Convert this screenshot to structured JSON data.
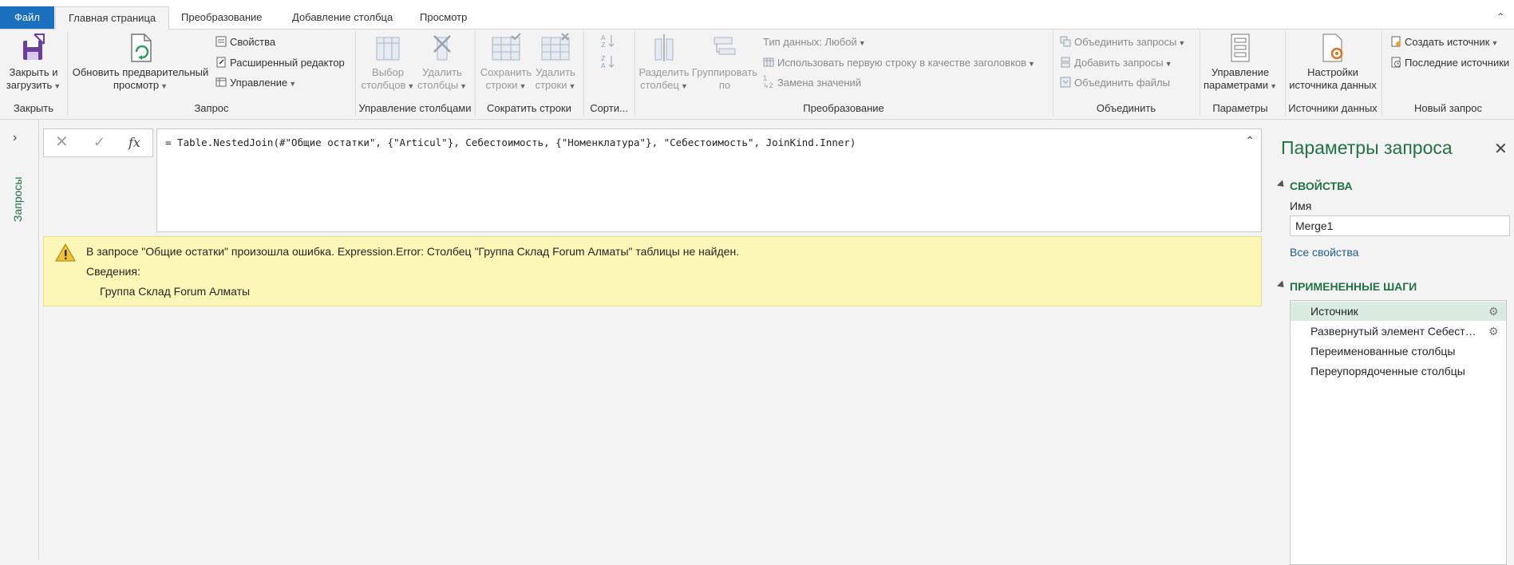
{
  "tabs": {
    "file": "Файл",
    "home": "Главная страница",
    "transform": "Преобразование",
    "add_column": "Добавление столбца",
    "view": "Просмотр"
  },
  "ribbon": {
    "close_group": {
      "close_load": [
        "Закрыть и",
        "загрузить"
      ],
      "label": "Закрыть"
    },
    "query_group": {
      "refresh": [
        "Обновить предварительный",
        "просмотр"
      ],
      "properties": "Свойства",
      "advanced_editor": "Расширенный редактор",
      "manage": "Управление",
      "label": "Запрос"
    },
    "columns_group": {
      "choose": [
        "Выбор",
        "столбцов"
      ],
      "remove": [
        "Удалить",
        "столбцы"
      ],
      "label": "Управление столбцами"
    },
    "rows_group": {
      "keep": [
        "Сохранить",
        "строки"
      ],
      "remove": [
        "Удалить",
        "строки"
      ],
      "label": "Сократить строки"
    },
    "sort_group": {
      "label": "Сорти..."
    },
    "transform_group": {
      "split": [
        "Разделить",
        "столбец"
      ],
      "group_by": [
        "Группировать",
        "по"
      ],
      "data_type": "Тип данных: Любой",
      "first_row_headers": "Использовать первую строку в качестве заголовков",
      "replace_values": "Замена значений",
      "label": "Преобразование"
    },
    "combine_group": {
      "merge": "Объединить запросы",
      "append": "Добавить запросы",
      "combine_files": "Объединить файлы",
      "label": "Объединить"
    },
    "params_group": {
      "manage_params": [
        "Управление",
        "параметрами"
      ],
      "label": "Параметры"
    },
    "sources_group": {
      "settings": [
        "Настройки",
        "источника данных"
      ],
      "label": "Источники данных"
    },
    "new_query_group": {
      "new_source": "Создать источник",
      "recent_sources": "Последние источники",
      "label": "Новый запрос"
    }
  },
  "queries_pane": {
    "label": "Запросы"
  },
  "formula_bar": {
    "fx": "fx",
    "text": "= Table.NestedJoin(#\"Общие остатки\", {\"Articul\"}, Себестоимость, {\"Номенклатура\"}, \"Себестоимость\", JoinKind.Inner)"
  },
  "error": {
    "message": "В запросе \"Общие остатки\" произошла ошибка. Expression.Error: Столбец \"Группа Склад Forum Алматы\" таблицы не найден.",
    "details_label": "Сведения:",
    "details_value": "Группа Склад Forum Алматы"
  },
  "query_settings": {
    "title": "Параметры запроса",
    "properties_header": "СВОЙСТВА",
    "name_label": "Имя",
    "name_value": "Merge1",
    "all_properties": "Все свойства",
    "steps_header": "ПРИМЕНЕННЫЕ ШАГИ",
    "steps": [
      "Источник",
      "Развернутый элемент Себестоимость",
      "Переименованные столбцы",
      "Переупорядоченные столбцы"
    ]
  },
  "colors": {
    "accent_green": "#217346",
    "file_blue": "#1a6fbf",
    "error_bg": "#fcf7b6",
    "selected_step": "#d9ecdf"
  }
}
